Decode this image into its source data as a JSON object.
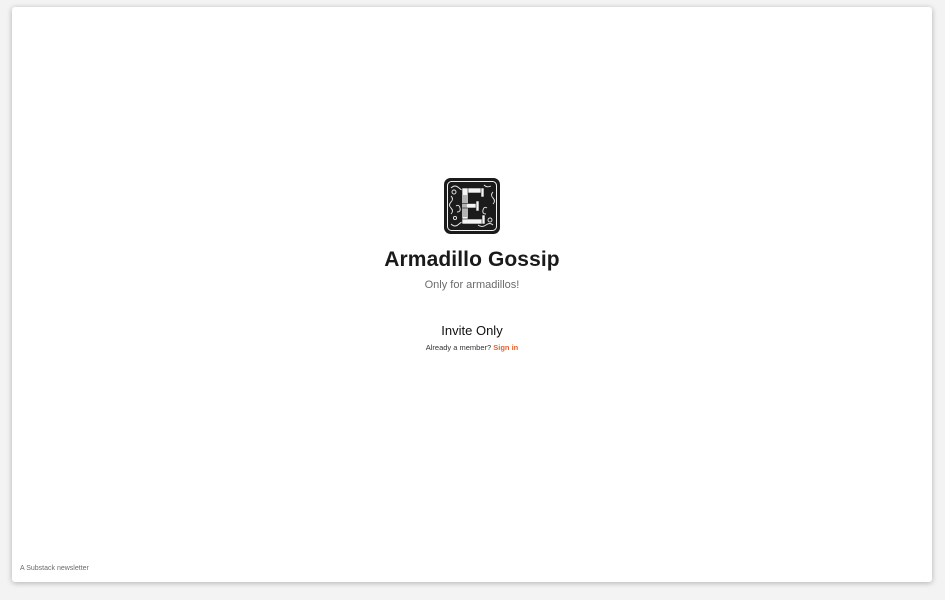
{
  "publication": {
    "title": "Armadillo Gossip",
    "subtitle": "Only for armadillos!",
    "logo_icon": "ornate-letter-e-logo"
  },
  "access": {
    "heading": "Invite Only",
    "member_prompt": "Already a member?",
    "sign_in_label": "Sign in"
  },
  "footer": {
    "note": "A Substack newsletter"
  },
  "colors": {
    "accent": "#e8622c",
    "title": "#1a1a1a",
    "muted": "#6b6b6b",
    "background": "#ffffff"
  }
}
